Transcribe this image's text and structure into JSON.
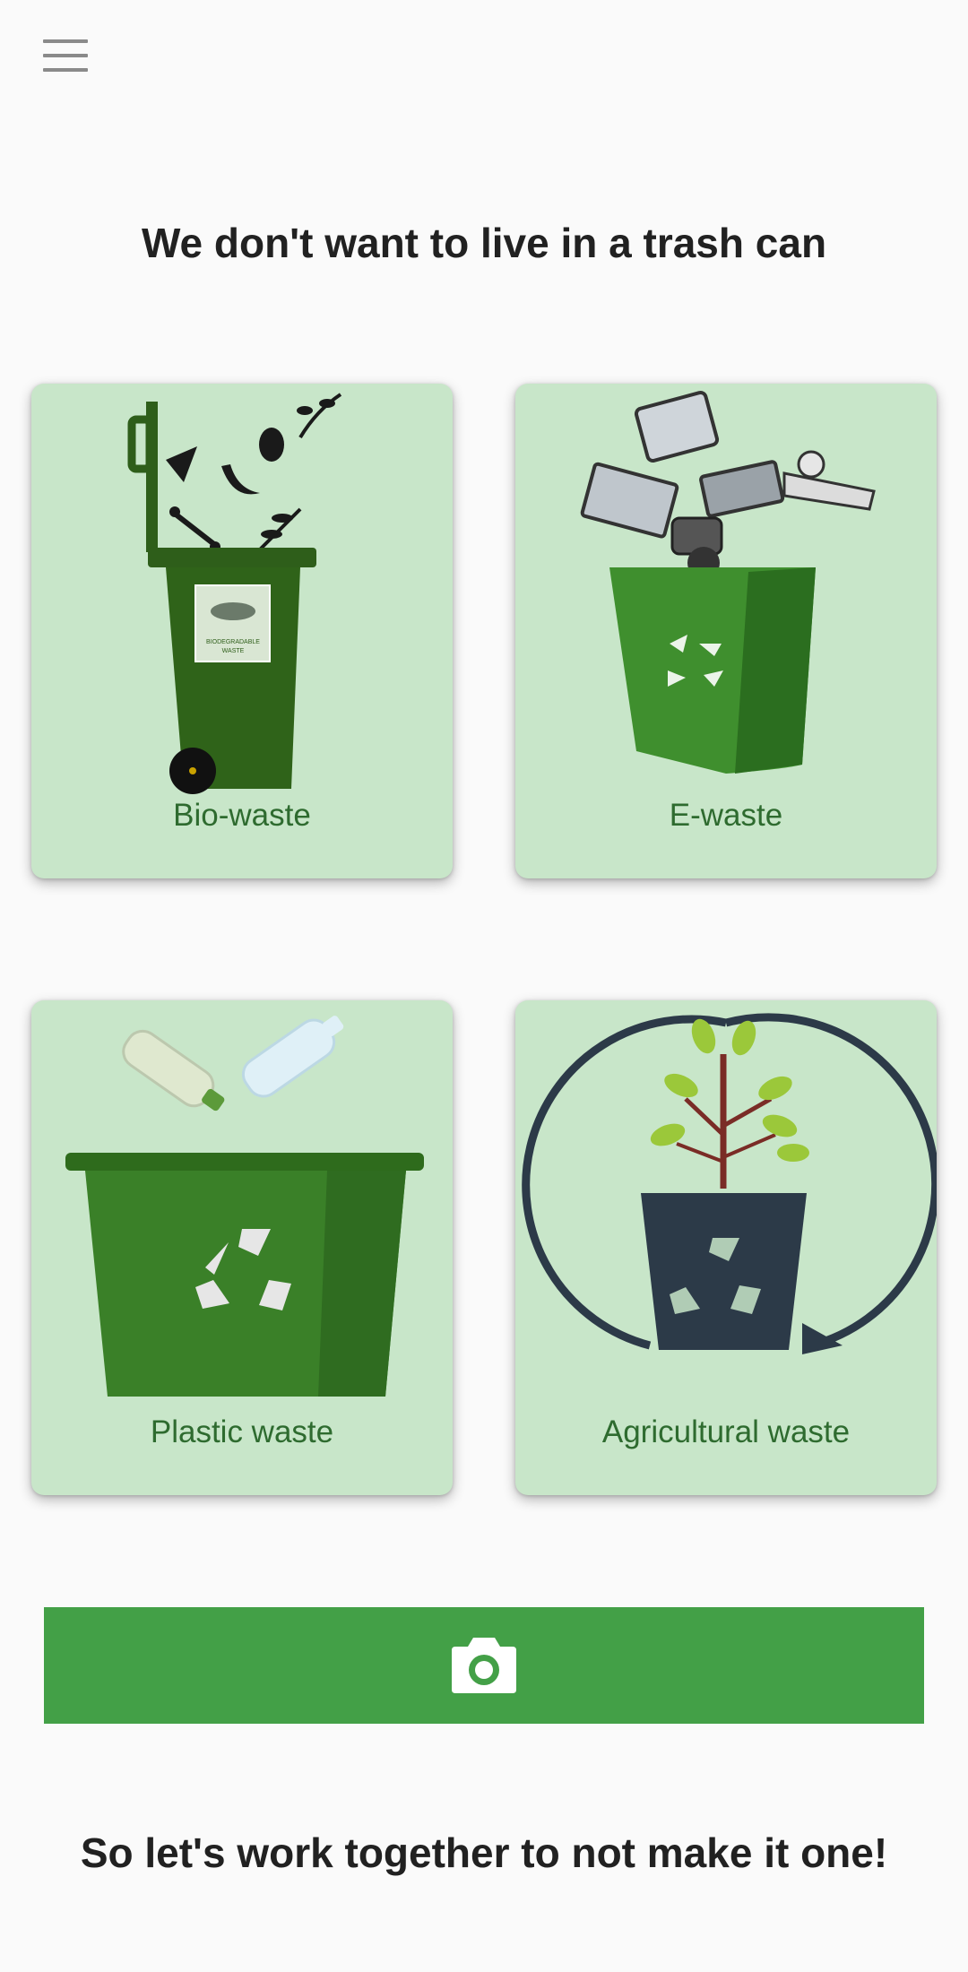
{
  "header": {
    "menu_icon": "hamburger-menu-icon",
    "title": "We don't want to live in a trash can"
  },
  "categories": [
    {
      "label": "Bio-waste",
      "icon": "biodegradable-bin-icon",
      "bin_text_1": "BIODEGRADABLE",
      "bin_text_2": "WASTE"
    },
    {
      "label": "E-waste",
      "icon": "e-waste-bin-icon"
    },
    {
      "label": "Plastic waste",
      "icon": "plastic-recycle-bin-icon"
    },
    {
      "label": "Agricultural waste",
      "icon": "agricultural-recycle-icon"
    }
  ],
  "camera_button": {
    "icon": "camera-icon"
  },
  "footer": {
    "text": "So let's work together to not make it one!"
  },
  "colors": {
    "background": "#fafafa",
    "card": "#c8e6c9",
    "card_label": "#2e6b2f",
    "button": "#43a047",
    "title": "#212121"
  }
}
